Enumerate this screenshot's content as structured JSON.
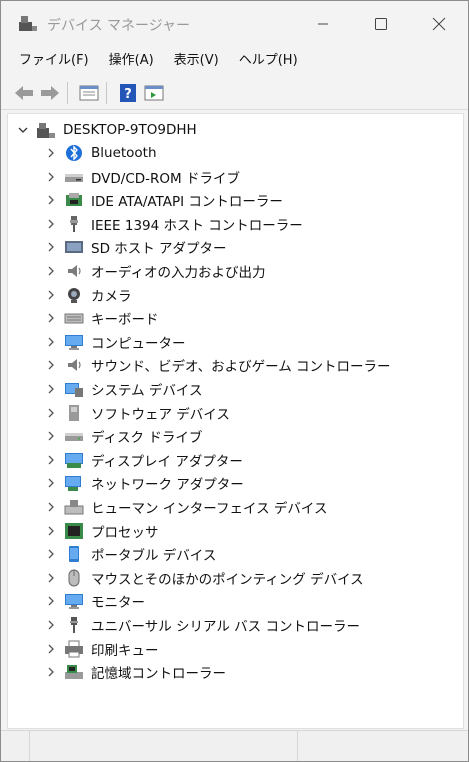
{
  "window": {
    "title": "デバイス マネージャー",
    "controls": {
      "minimize_icon": "minimize-icon",
      "maximize_icon": "maximize-icon",
      "close_icon": "close-icon"
    }
  },
  "menu": [
    "ファイル(F)",
    "操作(A)",
    "表示(V)",
    "ヘルプ(H)"
  ],
  "toolbar": [
    "back-arrow-icon",
    "forward-arrow-icon",
    "properties-view-icon",
    "help-icon",
    "show-hidden-icon"
  ],
  "tree": {
    "root": {
      "label": "DESKTOP-9TO9DHH",
      "icon": "computer-icon",
      "expanded": true
    },
    "items": [
      {
        "label": "Bluetooth",
        "icon": "bluetooth-icon"
      },
      {
        "label": "DVD/CD-ROM ドライブ",
        "icon": "dvd-drive-icon"
      },
      {
        "label": "IDE ATA/ATAPI コントローラー",
        "icon": "ide-controller-icon"
      },
      {
        "label": "IEEE 1394 ホスト コントローラー",
        "icon": "ieee1394-icon"
      },
      {
        "label": "SD ホスト アダプター",
        "icon": "sd-adapter-icon"
      },
      {
        "label": "オーディオの入力および出力",
        "icon": "speaker-icon"
      },
      {
        "label": "カメラ",
        "icon": "camera-icon"
      },
      {
        "label": "キーボード",
        "icon": "keyboard-icon"
      },
      {
        "label": "コンピューター",
        "icon": "monitor-icon"
      },
      {
        "label": "サウンド、ビデオ、およびゲーム コントローラー",
        "icon": "speaker-icon"
      },
      {
        "label": "システム デバイス",
        "icon": "system-device-icon"
      },
      {
        "label": "ソフトウェア デバイス",
        "icon": "software-device-icon"
      },
      {
        "label": "ディスク ドライブ",
        "icon": "disk-drive-icon"
      },
      {
        "label": "ディスプレイ アダプター",
        "icon": "display-adapter-icon"
      },
      {
        "label": "ネットワーク アダプター",
        "icon": "network-adapter-icon"
      },
      {
        "label": "ヒューマン インターフェイス デバイス",
        "icon": "hid-icon"
      },
      {
        "label": "プロセッサ",
        "icon": "processor-icon"
      },
      {
        "label": "ポータブル デバイス",
        "icon": "portable-device-icon"
      },
      {
        "label": "マウスとそのほかのポインティング デバイス",
        "icon": "mouse-icon"
      },
      {
        "label": "モニター",
        "icon": "monitor-icon"
      },
      {
        "label": "ユニバーサル シリアル バス コントローラー",
        "icon": "usb-icon"
      },
      {
        "label": "印刷キュー",
        "icon": "printer-icon"
      },
      {
        "label": "記憶域コントローラー",
        "icon": "storage-controller-icon"
      }
    ]
  },
  "colors": {
    "accent_blue": "#1e6fd9",
    "window_bg": "#f3f3f3",
    "pane_bg": "#ffffff"
  }
}
